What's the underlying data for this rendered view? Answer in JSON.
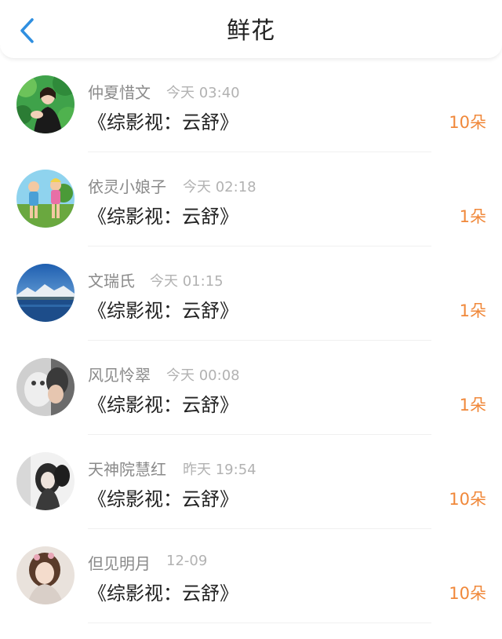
{
  "header": {
    "title": "鲜花",
    "back_icon": "chevron-left-icon",
    "accent_color": "#2f8fe0"
  },
  "colors": {
    "count": "#f0883a",
    "name": "#8a8a8a",
    "time": "#b2b2b2",
    "book": "#222222"
  },
  "items": [
    {
      "name": "仲夏惜文",
      "time": "今天 03:40",
      "book": "《综影视：云舒》",
      "count": "10朵"
    },
    {
      "name": "依灵小娘子",
      "time": "今天 02:18",
      "book": "《综影视：云舒》",
      "count": "1朵"
    },
    {
      "name": "文瑞氏",
      "time": "今天 01:15",
      "book": "《综影视：云舒》",
      "count": "1朵"
    },
    {
      "name": "风见怜翠",
      "time": "今天 00:08",
      "book": "《综影视：云舒》",
      "count": "1朵"
    },
    {
      "name": "天神院慧红",
      "time": "昨天 19:54",
      "book": "《综影视：云舒》",
      "count": "10朵"
    },
    {
      "name": "但见明月",
      "time": "12-09",
      "book": "《综影视：云舒》",
      "count": "10朵"
    }
  ]
}
